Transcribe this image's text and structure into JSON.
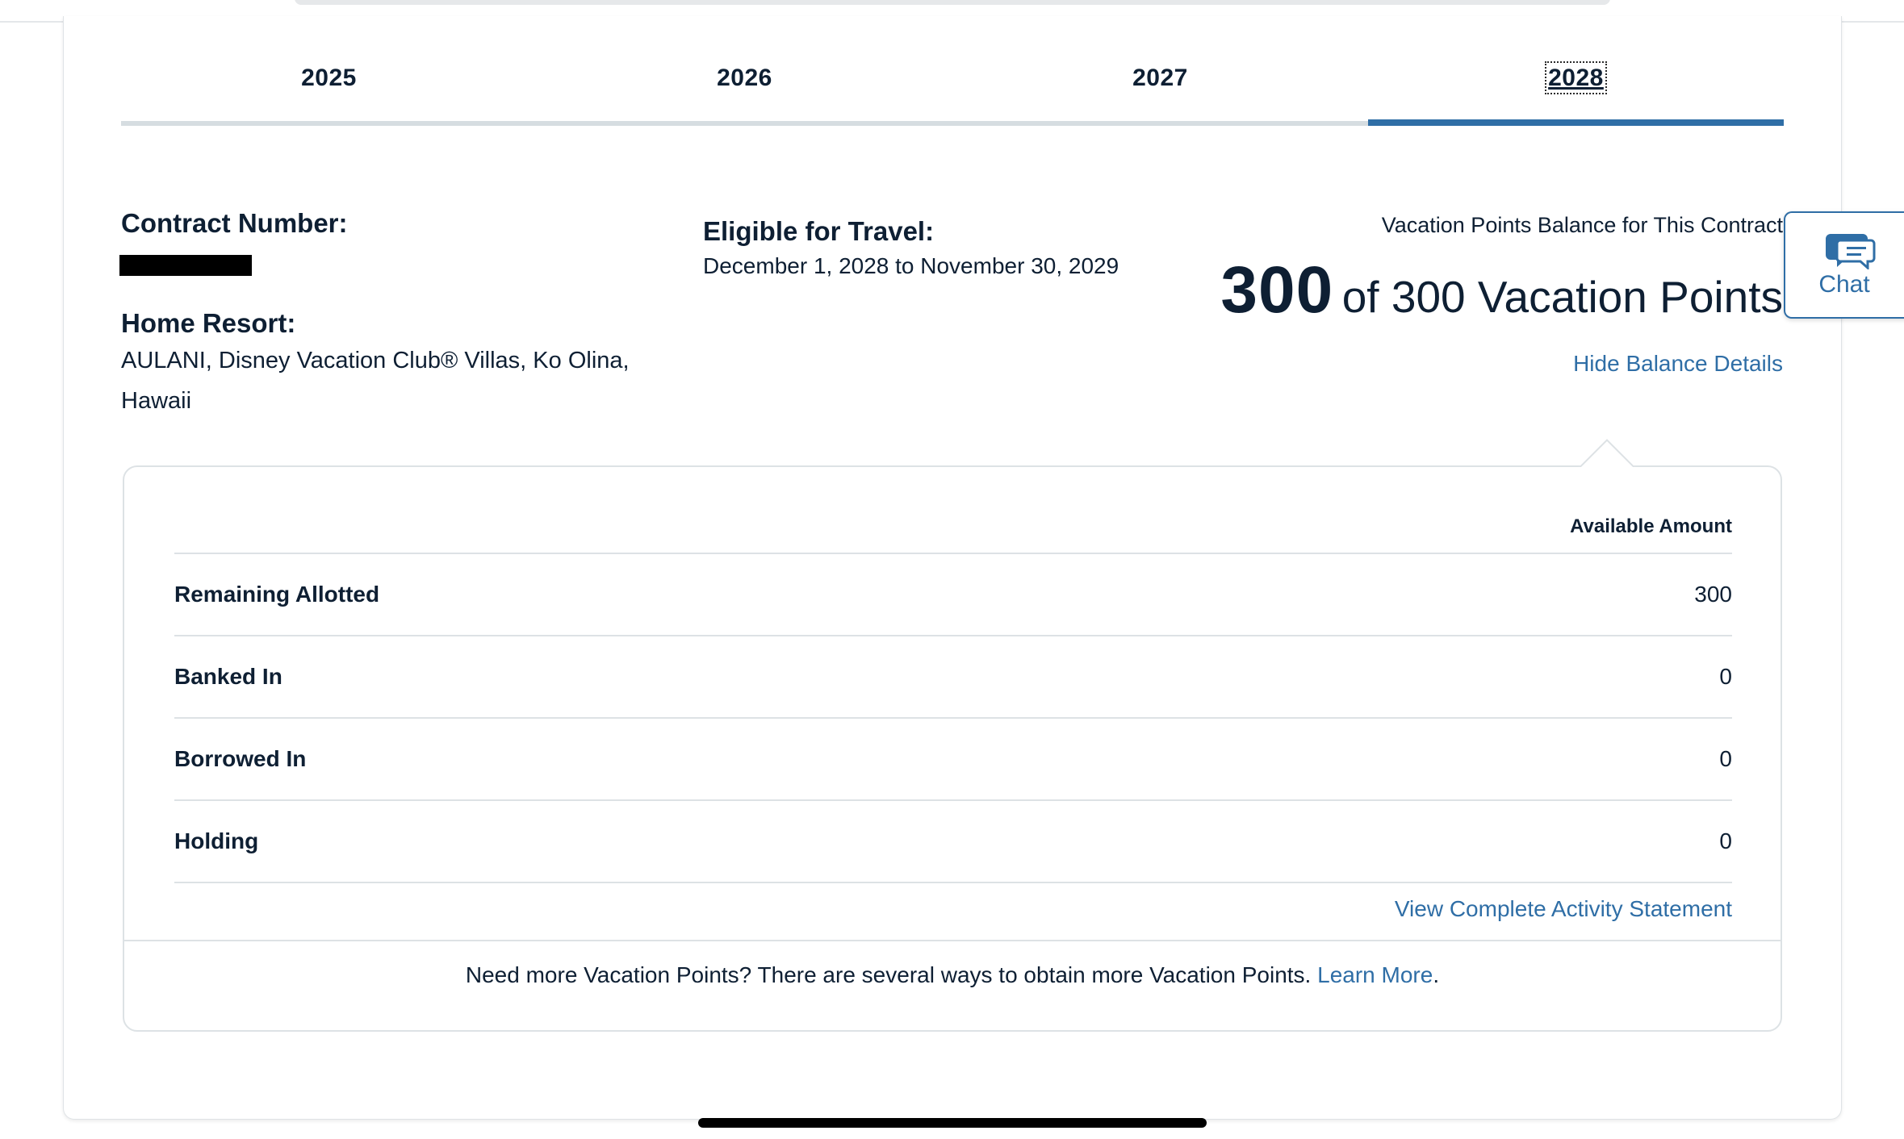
{
  "tabs": [
    {
      "label": "2025",
      "active": false
    },
    {
      "label": "2026",
      "active": false
    },
    {
      "label": "2027",
      "active": false
    },
    {
      "label": "2028",
      "active": true
    }
  ],
  "contract": {
    "number_label": "Contract Number:",
    "home_resort_label": "Home Resort:",
    "home_resort_value": "AULANI, Disney Vacation Club® Villas, Ko Olina, Hawaii"
  },
  "travel": {
    "label": "Eligible for Travel:",
    "value": "December 1, 2028 to November 30, 2029"
  },
  "balance": {
    "label": "Vacation Points Balance for This Contract",
    "available": "300",
    "total_text": "of 300 Vacation Points",
    "hide_link": "Hide Balance Details"
  },
  "details": {
    "column_header": "Available Amount",
    "rows": [
      {
        "label": "Remaining Allotted",
        "value": "300"
      },
      {
        "label": "Banked In",
        "value": "0"
      },
      {
        "label": "Borrowed In",
        "value": "0"
      },
      {
        "label": "Holding",
        "value": "0"
      }
    ],
    "activity_link": "View Complete Activity Statement",
    "footer_text": "Need more Vacation Points? There are several ways to obtain more Vacation Points. ",
    "footer_link": "Learn More",
    "footer_end": "."
  },
  "chat": {
    "label": "Chat",
    "icon": "chat-bubbles-icon"
  },
  "colors": {
    "accent": "#2f6ea6",
    "text": "#0e1f33",
    "divider": "#dde2e5"
  }
}
